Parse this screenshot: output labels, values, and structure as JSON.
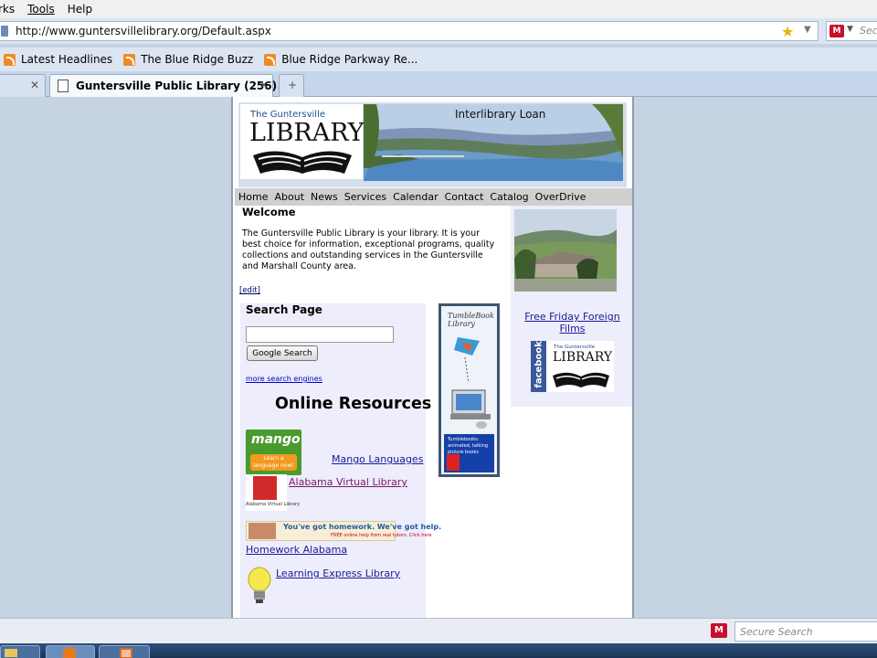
{
  "menu": [
    "rks",
    "Tools",
    "Help"
  ],
  "url": "http://www.guntersvillelibrary.org/Default.aspx",
  "search_placeholder": "Secu",
  "bookmarks": [
    "Latest Headlines",
    "The Blue Ridge Buzz",
    "Blue Ridge Parkway Re..."
  ],
  "tab_title": "Guntersville Public Library (256) 5...",
  "header": {
    "logo_small": "The Guntersville",
    "logo_big": "LIBRARY",
    "banner_text": "Interlibrary Loan"
  },
  "nav": [
    "Home",
    "About",
    "News",
    "Services",
    "Calendar",
    "Contact",
    "Catalog",
    "OverDrive"
  ],
  "welcome_title": "Welcome",
  "intro_text": "The Guntersville Public Library is your library.  It is your best choice for information, exceptional programs, quality collections and outstanding services in the Guntersville and Marshall County area.",
  "edit_link": "[edit]",
  "search": {
    "title": "Search Page",
    "button": "Google Search",
    "more_link": "more search engines"
  },
  "online_resources_title": "Online Resources",
  "resources": {
    "mango": "Mango Languages",
    "mango_logo_word": "mango",
    "mango_logo_btn": "Learn a language now!",
    "avl": "Alabama Virtual Library",
    "avl_logo_text": "Alabama Virtual Library",
    "homework": "Homework Alabama",
    "homework_banner": "You've got homework. We've got help.",
    "homework_banner_sub": "FREE online help from real tutors. Click here",
    "learning": "Learning Express Library"
  },
  "tumblebook": {
    "word": "TumbleBook Library",
    "blue_text": "Tumblebooks: animated, talking picture books"
  },
  "right": {
    "films_link": "Free Friday Foreign Films",
    "facebook": "facebook",
    "fb_logo_small": "The Guntersville",
    "fb_logo_big": "LIBRARY"
  },
  "status_search": "Secure Search"
}
